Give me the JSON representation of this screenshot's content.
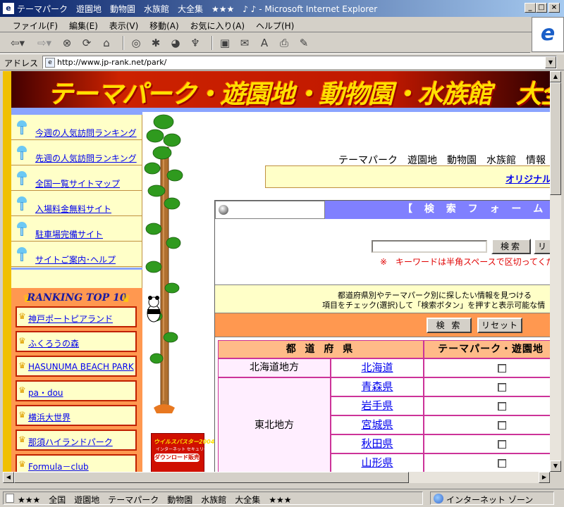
{
  "window": {
    "title": "テーマパーク　遊園地　動物園　水族館　大全集　★★★　♪ ♪ - Microsoft Internet Explorer"
  },
  "menu": [
    "ファイル(F)",
    "編集(E)",
    "表示(V)",
    "移動(A)",
    "お気に入り(A)",
    "ヘルプ(H)"
  ],
  "toolbar": {
    "icons": [
      "back-icon",
      "forward-icon",
      "stop-icon",
      "refresh-icon",
      "home-icon",
      "search-icon",
      "favorites-icon",
      "history-icon",
      "channels-icon",
      "fullscreen-icon",
      "mail-icon",
      "font-icon",
      "print-icon",
      "edit-icon"
    ]
  },
  "address": {
    "label": "アドレス",
    "url": "http://www.jp-rank.net/park/"
  },
  "page": {
    "banner_title": "テーマパーク・遊園地・動物園・水族館　大全集！",
    "tagline": "テーマパーク　遊園地　動物園　水族館　情報",
    "original_link": "オリジナル",
    "nav": [
      "今週の人気訪問ランキング",
      "先週の人気訪問ランキング",
      "全国一覧サイトマップ",
      "入場料金無料サイト",
      "駐車場完備サイト",
      "サイトご案内･ヘルプ"
    ],
    "ranking": {
      "title": "RANKING TOP 10",
      "items": [
        "神戸ポートピアランド",
        "ふくろうの森",
        "HASUNUMA BEACH PARK",
        "pa・dou",
        "横浜大世界",
        "那須ハイランドパーク",
        "Formula－club"
      ]
    },
    "ad": {
      "title": "ウイルスバスター2004",
      "subtitle": "インターネット セキュリティ",
      "download": "ダウンロード販売"
    },
    "search": {
      "header": "【 検 索 フ ォ ー ム 】",
      "input_value": "",
      "search_button": "検索",
      "reset_button_partial": "リ",
      "note": "※　キーワードは半角スペースで区切ってくだ",
      "desc_line1": "都道府県別やテーマパーク別に探したい情報を見つける",
      "desc_line2": "項目をチェック(選択)して「検索ボタン」を押すと表示可能な情",
      "search_button2": "検 索",
      "reset_button2": "リセット"
    },
    "table": {
      "headers": [
        "都 道 府 県",
        "テーマパーク・遊園地"
      ],
      "rows": [
        {
          "region": "北海道地方",
          "prefectures": [
            "北海道"
          ]
        },
        {
          "region": "東北地方",
          "prefectures": [
            "青森県",
            "岩手県",
            "宮城県",
            "秋田県",
            "山形県"
          ]
        }
      ]
    }
  },
  "status": {
    "text": "★★★　全国　遊園地　テーマパーク　動物園　水族館　大全集　★★★",
    "zone": "インターネット ゾーン"
  }
}
